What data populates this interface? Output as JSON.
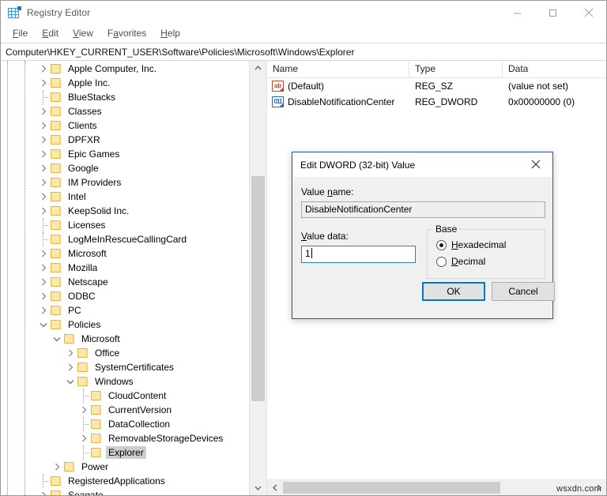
{
  "window": {
    "title": "Registry Editor",
    "app_icon": "registry-editor-icon",
    "minimize_label": "Minimize",
    "maximize_label": "Maximize",
    "close_label": "Close"
  },
  "menubar": {
    "items": [
      {
        "label": "File",
        "mnemonic": "F",
        "rest": "ile"
      },
      {
        "label": "Edit",
        "mnemonic": "E",
        "rest": "dit"
      },
      {
        "label": "View",
        "mnemonic": "V",
        "rest": "iew"
      },
      {
        "label": "Favorites",
        "pre": "F",
        "mnemonic": "a",
        "rest": "vorites"
      },
      {
        "label": "Help",
        "mnemonic": "H",
        "rest": "elp"
      }
    ]
  },
  "address": {
    "path": "Computer\\HKEY_CURRENT_USER\\Software\\Policies\\Microsoft\\Windows\\Explorer"
  },
  "tree": {
    "items": [
      {
        "label": "Apple Computer, Inc.",
        "depth": 0,
        "state": "collapsed",
        "selected": false
      },
      {
        "label": "Apple Inc.",
        "depth": 0,
        "state": "collapsed",
        "selected": false
      },
      {
        "label": "BlueStacks",
        "depth": 0,
        "state": "leaf",
        "selected": false
      },
      {
        "label": "Classes",
        "depth": 0,
        "state": "collapsed",
        "selected": false
      },
      {
        "label": "Clients",
        "depth": 0,
        "state": "collapsed",
        "selected": false
      },
      {
        "label": "DPFXR",
        "depth": 0,
        "state": "collapsed",
        "selected": false
      },
      {
        "label": "Epic Games",
        "depth": 0,
        "state": "collapsed",
        "selected": false
      },
      {
        "label": "Google",
        "depth": 0,
        "state": "collapsed",
        "selected": false
      },
      {
        "label": "IM Providers",
        "depth": 0,
        "state": "collapsed",
        "selected": false
      },
      {
        "label": "Intel",
        "depth": 0,
        "state": "collapsed",
        "selected": false
      },
      {
        "label": "KeepSolid Inc.",
        "depth": 0,
        "state": "collapsed",
        "selected": false
      },
      {
        "label": "Licenses",
        "depth": 0,
        "state": "leaf",
        "selected": false
      },
      {
        "label": "LogMeInRescueCallingCard",
        "depth": 0,
        "state": "leaf",
        "selected": false
      },
      {
        "label": "Microsoft",
        "depth": 0,
        "state": "collapsed",
        "selected": false
      },
      {
        "label": "Mozilla",
        "depth": 0,
        "state": "collapsed",
        "selected": false
      },
      {
        "label": "Netscape",
        "depth": 0,
        "state": "collapsed",
        "selected": false
      },
      {
        "label": "ODBC",
        "depth": 0,
        "state": "collapsed",
        "selected": false
      },
      {
        "label": "PC",
        "depth": 0,
        "state": "collapsed",
        "selected": false
      },
      {
        "label": "Policies",
        "depth": 0,
        "state": "expanded",
        "selected": false
      },
      {
        "label": "Microsoft",
        "depth": 1,
        "state": "expanded",
        "selected": false
      },
      {
        "label": "Office",
        "depth": 2,
        "state": "collapsed",
        "selected": false
      },
      {
        "label": "SystemCertificates",
        "depth": 2,
        "state": "collapsed",
        "selected": false
      },
      {
        "label": "Windows",
        "depth": 2,
        "state": "expanded",
        "selected": false
      },
      {
        "label": "CloudContent",
        "depth": 3,
        "state": "leaf",
        "selected": false
      },
      {
        "label": "CurrentVersion",
        "depth": 3,
        "state": "collapsed",
        "selected": false
      },
      {
        "label": "DataCollection",
        "depth": 3,
        "state": "leaf",
        "selected": false
      },
      {
        "label": "RemovableStorageDevices",
        "depth": 3,
        "state": "collapsed",
        "selected": false
      },
      {
        "label": "Explorer",
        "depth": 3,
        "state": "leaf",
        "selected": true
      },
      {
        "label": "Power",
        "depth": 1,
        "state": "collapsed",
        "selected": false
      },
      {
        "label": "RegisteredApplications",
        "depth": 0,
        "state": "leaf",
        "selected": false
      },
      {
        "label": "Seagate",
        "depth": 0,
        "state": "collapsed",
        "selected": false
      }
    ]
  },
  "list": {
    "columns": [
      "Name",
      "Type",
      "Data"
    ],
    "rows": [
      {
        "icon": "string-value-icon",
        "icon_text": "ab",
        "name": "(Default)",
        "type": "REG_SZ",
        "data": "(value not set)"
      },
      {
        "icon": "dword-value-icon",
        "icon_text": "011",
        "name": "DisableNotificationCenter",
        "type": "REG_DWORD",
        "data": "0x00000000 (0)"
      }
    ]
  },
  "dialog": {
    "title": "Edit DWORD (32-bit) Value",
    "close_label": "Close",
    "value_name_label": "Value name:",
    "value_name_label_pre": "Value ",
    "value_name_label_mnemonic": "n",
    "value_name_label_rest": "ame:",
    "value_name": "DisableNotificationCenter",
    "value_data_label": "Value data:",
    "value_data_label_mnemonic": "V",
    "value_data_label_rest": "alue data:",
    "value_data": "1",
    "base_legend": "Base",
    "base_options": [
      {
        "label": "Hexadecimal",
        "mnemonic": "H",
        "rest": "exadecimal",
        "selected": true
      },
      {
        "label": "Decimal",
        "mnemonic": "D",
        "rest": "ecimal",
        "selected": false
      }
    ],
    "ok_label": "OK",
    "cancel_label": "Cancel"
  },
  "watermark": {
    "text": "wsxdn.com"
  },
  "colors": {
    "accent": "#0078d7",
    "dialog_border": "#2b579a",
    "folder": "#fbd87c",
    "selection": "#cdcdcd"
  }
}
